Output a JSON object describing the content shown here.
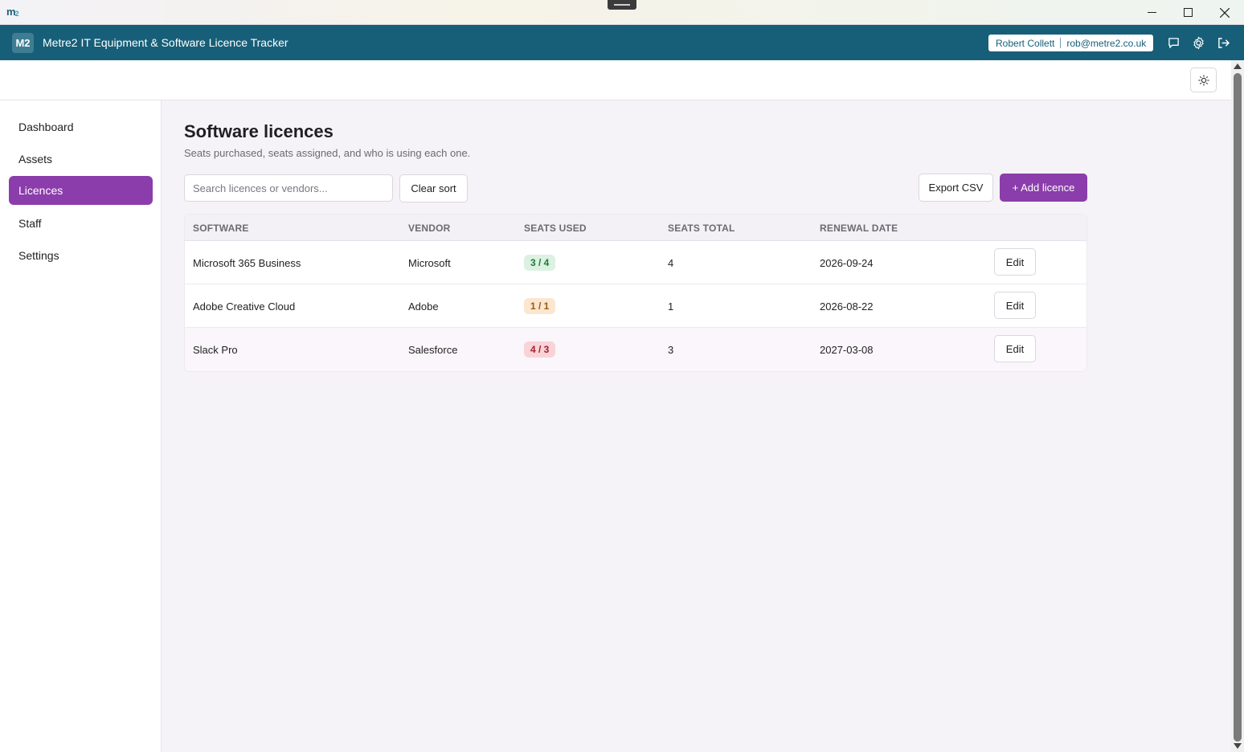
{
  "os": {
    "logo_text": "m",
    "logo_sub": "2",
    "minimize_label": "—",
    "maximize_label": "☐",
    "close_label": "✕"
  },
  "header": {
    "badge": "M2",
    "title": "Metre2 IT Equipment & Software Licence Tracker",
    "user_name": "Robert Collett",
    "user_email": "rob@metre2.co.uk",
    "icons": [
      "chat-icon",
      "gear-icon",
      "logout-icon"
    ]
  },
  "toolbar": {
    "theme_icon": "sun-icon"
  },
  "sidebar": {
    "items": [
      {
        "label": "Dashboard",
        "active": false
      },
      {
        "label": "Assets",
        "active": false
      },
      {
        "label": "Licences",
        "active": true
      },
      {
        "label": "Staff",
        "active": false
      },
      {
        "label": "Settings",
        "active": false
      }
    ]
  },
  "main": {
    "title": "Software licences",
    "subtitle": "Seats purchased, seats assigned, and who is using each one.",
    "search_placeholder": "Search licences or vendors...",
    "clear_sort_label": "Clear sort",
    "export_label": "Export CSV",
    "add_label": "+ Add licence",
    "columns": [
      "SOFTWARE",
      "VENDOR",
      "SEATS USED",
      "SEATS TOTAL",
      "RENEWAL DATE"
    ],
    "rows": [
      {
        "software": "Microsoft 365 Business",
        "vendor": "Microsoft",
        "seats_used": "3 / 4",
        "status": "green",
        "seats_total": "4",
        "renewal": "2026-09-24",
        "action": "Edit"
      },
      {
        "software": "Adobe Creative Cloud",
        "vendor": "Adobe",
        "seats_used": "1 / 1",
        "status": "amber",
        "seats_total": "1",
        "renewal": "2026-08-22",
        "action": "Edit"
      },
      {
        "software": "Slack Pro",
        "vendor": "Salesforce",
        "seats_used": "4 / 3",
        "status": "red",
        "seats_total": "3",
        "renewal": "2027-03-08",
        "action": "Edit"
      }
    ]
  },
  "colors": {
    "header": "#175f78",
    "accent": "#8b3dab",
    "ok": "#217a3c",
    "warn": "#9a5a10",
    "over": "#a4202f"
  }
}
